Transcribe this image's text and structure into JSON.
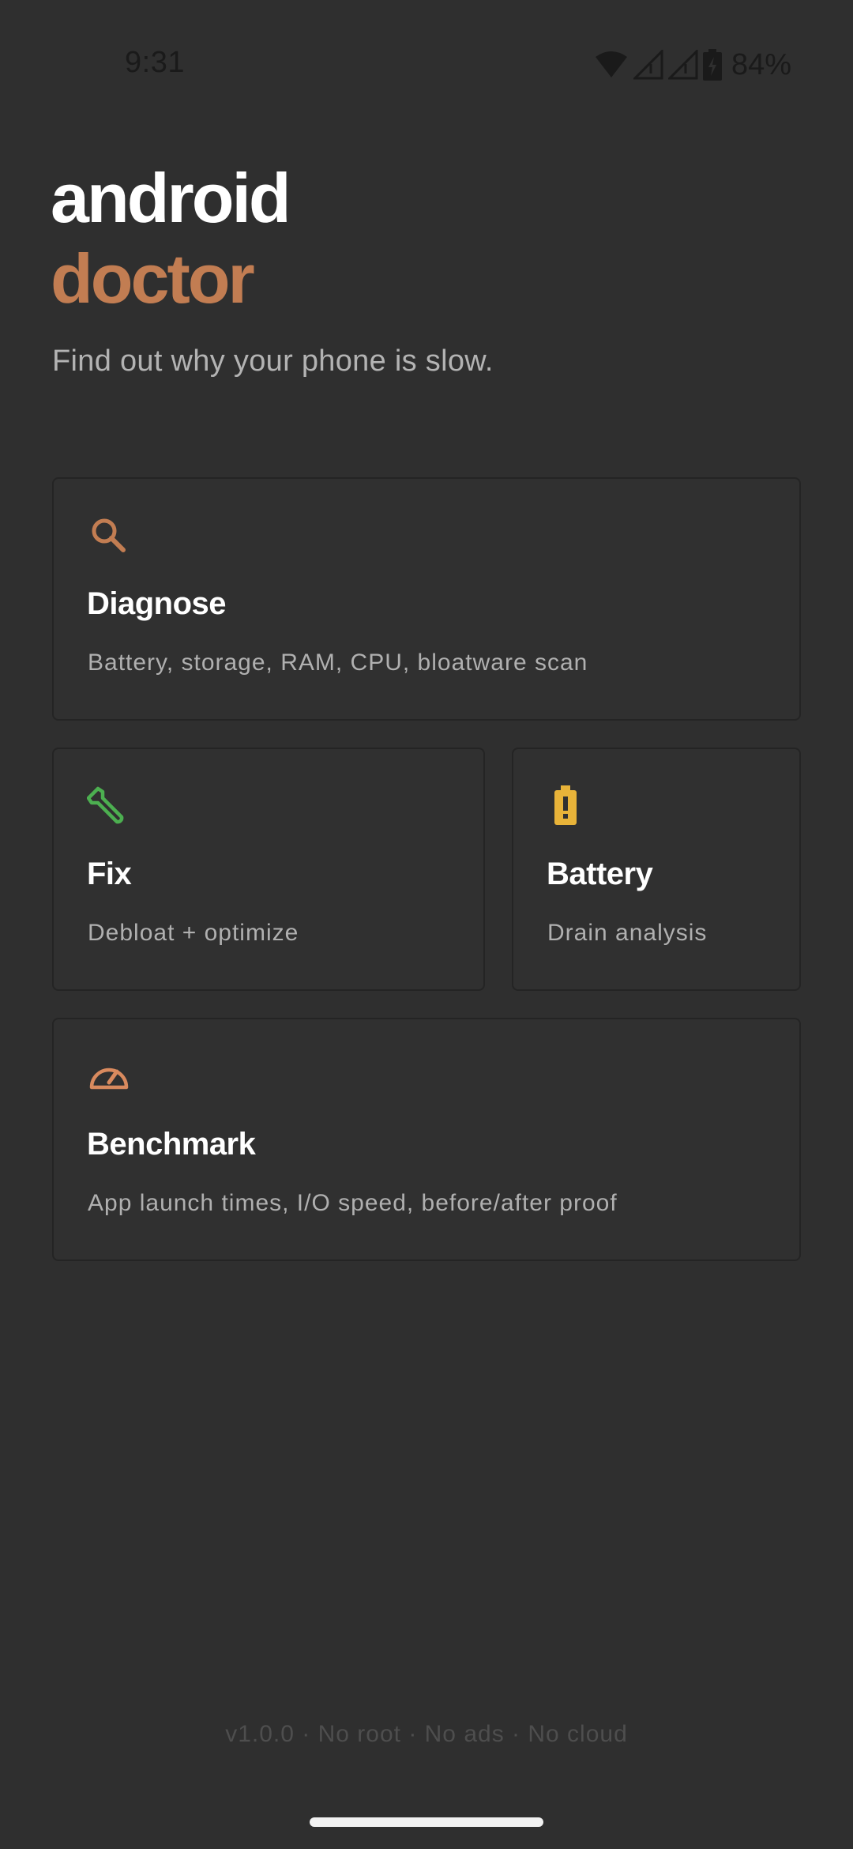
{
  "status_bar": {
    "time": "9:31",
    "battery_percent": "84%",
    "icons": [
      "wifi-icon",
      "signal-icon",
      "signal-icon",
      "battery-charging-icon"
    ]
  },
  "header": {
    "title_line1": "android",
    "title_line2": "doctor",
    "subtitle": "Find out why your phone is slow."
  },
  "cards": {
    "diagnose": {
      "title": "Diagnose",
      "description": "Battery, storage, RAM, CPU, bloatware scan",
      "icon": "search-icon",
      "icon_color": "#c27d52"
    },
    "fix": {
      "title": "Fix",
      "description": "Debloat + optimize",
      "icon": "wrench-icon",
      "icon_color": "#4caf50"
    },
    "battery": {
      "title": "Battery",
      "description": "Drain analysis",
      "icon": "battery-alert-icon",
      "icon_color": "#e8b339"
    },
    "benchmark": {
      "title": "Benchmark",
      "description": "App launch times, I/O speed, before/after proof",
      "icon": "speedometer-icon",
      "icon_color": "#d98a5e"
    }
  },
  "footer": {
    "text": "v1.0.0 · No root · No ads · No cloud"
  },
  "colors": {
    "background": "#2f2f2f",
    "accent": "#c27d52",
    "card_border": "#242424"
  }
}
